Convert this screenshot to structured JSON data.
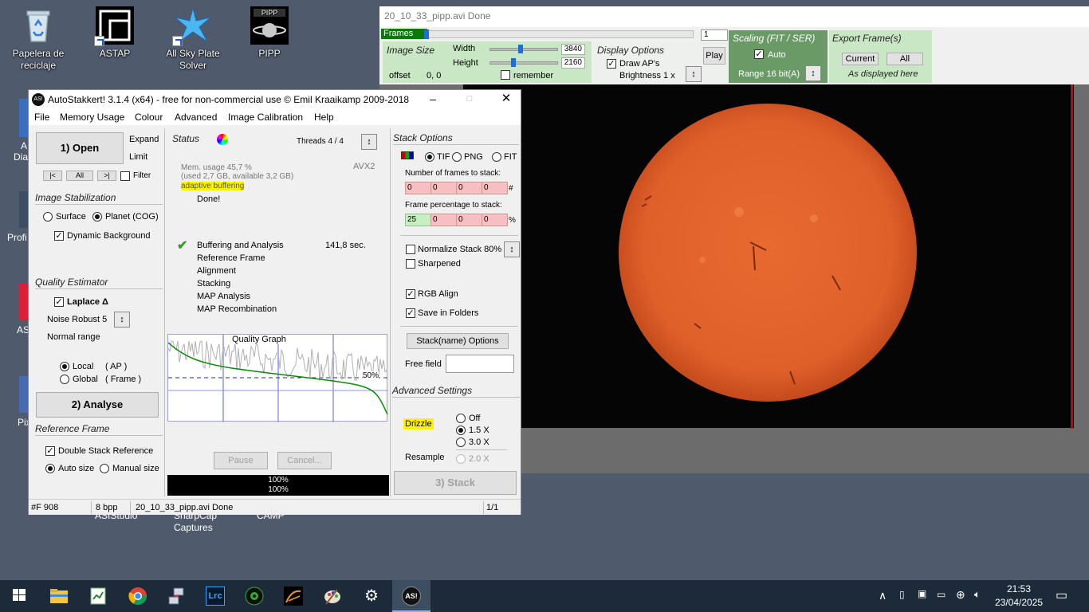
{
  "desktop": {
    "icons": [
      {
        "label": "Papelera de reciclaje",
        "icon": "recycle-bin-icon"
      },
      {
        "label": "ASTAP",
        "icon": "astap-icon"
      },
      {
        "label": "All Sky Plate Solver",
        "icon": "all-sky-plate-solver-icon"
      },
      {
        "label": "PIPP",
        "icon": "pipp-icon"
      }
    ],
    "partial_labels": [
      "A",
      "Dia",
      "Profi",
      "AS",
      "Pix"
    ],
    "below_labels": [
      "ASIStudio",
      "SharpCap",
      "Captures",
      "CAMP"
    ]
  },
  "preview": {
    "title": "20_10_33_pipp.avi   Done",
    "frames_label": "Frames",
    "frame_number": "1",
    "image_size": {
      "title": "Image Size",
      "width_label": "Width",
      "width_value": "3840",
      "height_label": "Height",
      "height_value": "2160",
      "offset_label": "offset",
      "offset_value": "0, 0",
      "remember_label": "remember"
    },
    "display_options": {
      "title": "Display Options",
      "draw_aps_label": "Draw AP's",
      "play_label": "Play",
      "brightness_label": "Brightness  1 x"
    },
    "scaling": {
      "title": "Scaling (FIT / SER)",
      "auto_label": "Auto",
      "range_label": "Range 16 bit(A)"
    },
    "export": {
      "title": "Export Frame(s)",
      "current_label": "Current",
      "all_label": "All",
      "note": "As displayed here"
    }
  },
  "autostakkert": {
    "title": "AutoStakkert! 3.1.4 (x64) - free for non-commercial use © Emil Kraaikamp 2009-2018",
    "logo": "AS!",
    "menu": [
      "File",
      "Memory Usage",
      "Colour",
      "Advanced",
      "Image Calibration",
      "Help"
    ],
    "open_button": "1) Open",
    "expand_label": "Expand",
    "limit_label": "Limit",
    "nav_prev": "|<",
    "nav_all": "All",
    "nav_next": ">|",
    "filter_label": "Filter",
    "image_stabilization": {
      "title": "Image Stabilization",
      "surface": "Surface",
      "planet": "Planet (COG)",
      "dynamic_bg": "Dynamic Background"
    },
    "quality_estimator": {
      "title": "Quality Estimator",
      "laplace": "Laplace Δ",
      "noise_robust": "Noise Robust  5",
      "normal_range": "Normal range",
      "local": "Local",
      "local_suffix": "( AP )",
      "global": "Global",
      "global_suffix": "( Frame )"
    },
    "analyse_button": "2) Analyse",
    "reference_frame": {
      "title": "Reference Frame",
      "double_stack": "Double Stack Reference",
      "auto_size": "Auto size",
      "manual_size": "Manual size"
    },
    "status": {
      "title": "Status",
      "threads": "Threads 4 / 4",
      "mem_line1": "Mem. usage 45,7 %",
      "mem_line2": "(used 2,7 GB, available 3,2 GB)",
      "avx": "AVX2",
      "adaptive": "adaptive buffering",
      "done": "Done!",
      "steps": [
        "Buffering and Analysis",
        "Reference Frame",
        "Alignment",
        "Stacking",
        "MAP Analysis",
        "MAP Recombination"
      ],
      "buffering_time": "141,8 sec.",
      "graph_title": "Quality Graph",
      "graph_pct": "50%",
      "pause": "Pause",
      "cancel": "Cancel...",
      "progress1": "100%",
      "progress2": "100%"
    },
    "stack_options": {
      "title": "Stack Options",
      "tif": "TIF",
      "png": "PNG",
      "fit": "FIT",
      "frames_label": "Number of frames to stack:",
      "frames_values": [
        "0",
        "0",
        "0",
        "0"
      ],
      "frames_unit": "#",
      "pct_label": "Frame percentage to stack:",
      "pct_values": [
        "25",
        "0",
        "0",
        "0"
      ],
      "pct_unit": "%",
      "normalize": "Normalize Stack 80%",
      "sharpened": "Sharpened",
      "rgb_align": "RGB Align",
      "save_folders": "Save in Folders",
      "stackname_button": "Stack(name) Options",
      "free_field": "Free field"
    },
    "advanced_settings": {
      "title": "Advanced Settings",
      "drizzle": "Drizzle",
      "off": "Off",
      "x15": "1.5 X",
      "x30": "3.0 X",
      "resample": "Resample",
      "x20": "2.0 X"
    },
    "stack_button": "3) Stack",
    "statusbar": {
      "frames": "#F 908",
      "bpp": "8 bpp",
      "file": "20_10_33_pipp.avi   Done",
      "page": "1/1"
    }
  },
  "taskbar": {
    "time": "21:53",
    "date": "23/04/2025",
    "apps": [
      "windows-start-icon",
      "file-explorer-icon",
      "notepad-icon",
      "chrome-icon",
      "network-app-icon",
      "lightroom-icon",
      "video-app-icon",
      "sky-app-icon",
      "paint-icon",
      "settings-gear-icon",
      "autostakkert-icon"
    ]
  },
  "colors": {
    "sun": "#e2622a",
    "panel_green": "#c9e7c4",
    "taskbar": "#1c2a3a",
    "desktop": "#4f5b6d"
  }
}
